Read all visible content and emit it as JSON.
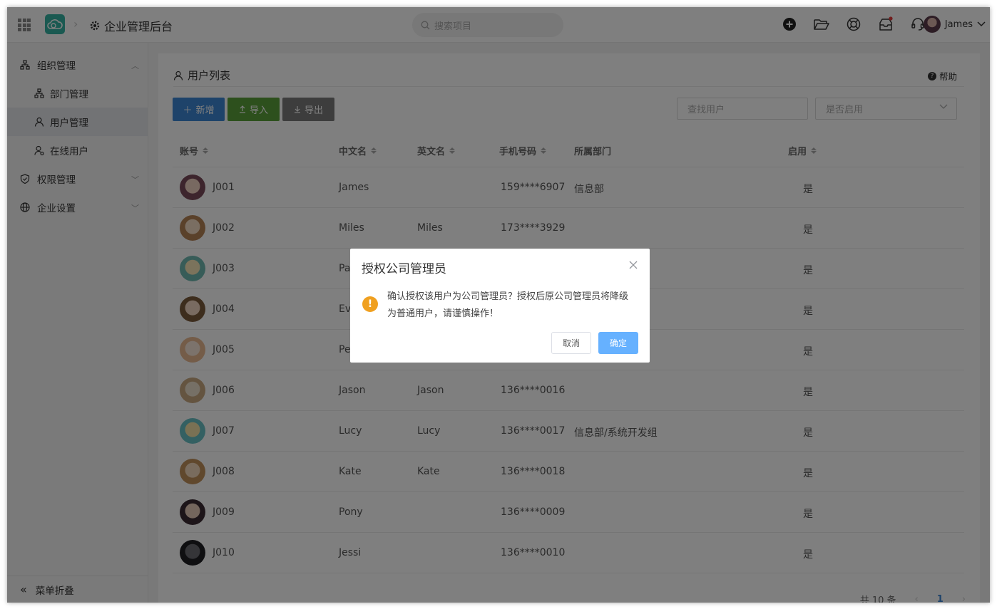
{
  "header": {
    "title": "企业管理后台",
    "search_placeholder": "搜索项目",
    "user_name": "James"
  },
  "sidebar": {
    "items": [
      {
        "label": "组织管理"
      },
      {
        "label": "部门管理"
      },
      {
        "label": "用户管理"
      },
      {
        "label": "在线用户"
      },
      {
        "label": "权限管理"
      },
      {
        "label": "企业设置"
      }
    ],
    "collapse_label": "菜单折叠"
  },
  "main": {
    "title": "用户列表",
    "help_label": "帮助",
    "buttons": {
      "add": "新增",
      "import": "导入",
      "export": "导出"
    },
    "find_placeholder": "查找用户",
    "enable_placeholder": "是否启用",
    "columns": [
      "账号",
      "中文名",
      "英文名",
      "手机号码",
      "所属部门",
      "启用"
    ],
    "rows": [
      {
        "account": "J001",
        "cn": "James",
        "en": "",
        "phone": "159****6907",
        "dept": "信息部",
        "enabled": "是"
      },
      {
        "account": "J002",
        "cn": "Miles",
        "en": "Miles",
        "phone": "173****3929",
        "dept": "",
        "enabled": "是"
      },
      {
        "account": "J003",
        "cn": "Pa",
        "en": "",
        "phone": "",
        "dept": "",
        "enabled": "是"
      },
      {
        "account": "J004",
        "cn": "Ev",
        "en": "",
        "phone": "",
        "dept": "组",
        "enabled": "是"
      },
      {
        "account": "J005",
        "cn": "Pe",
        "en": "",
        "phone": "",
        "dept": "",
        "enabled": "是"
      },
      {
        "account": "J006",
        "cn": "Jason",
        "en": "Jason",
        "phone": "136****0016",
        "dept": "",
        "enabled": "是"
      },
      {
        "account": "J007",
        "cn": "Lucy",
        "en": "Lucy",
        "phone": "136****0017",
        "dept": "信息部/系统开发组",
        "enabled": "是"
      },
      {
        "account": "J008",
        "cn": "Kate",
        "en": "Kate",
        "phone": "136****0018",
        "dept": "",
        "enabled": "是"
      },
      {
        "account": "J009",
        "cn": "Pony",
        "en": "",
        "phone": "136****0009",
        "dept": "",
        "enabled": "是"
      },
      {
        "account": "J010",
        "cn": "Jessi",
        "en": "",
        "phone": "136****0010",
        "dept": "",
        "enabled": "是"
      }
    ],
    "pager": {
      "total": "共 10 条",
      "page": "1"
    }
  },
  "dialog": {
    "title": "授权公司管理员",
    "message": "确认授权该用户为公司管理员？授权后原公司管理员将降级为普通用户，请谨慎操作！",
    "cancel_label": "取消",
    "ok_label": "确定"
  },
  "colors": {
    "primary": "#3d87d4",
    "import_green": "#5aa13a",
    "export_gray": "#7a7a7a",
    "confirm_blue": "#66b1ff",
    "warning": "#f0a020",
    "annotation_red": "#e8262a",
    "logo_teal": "#35b3a3"
  }
}
